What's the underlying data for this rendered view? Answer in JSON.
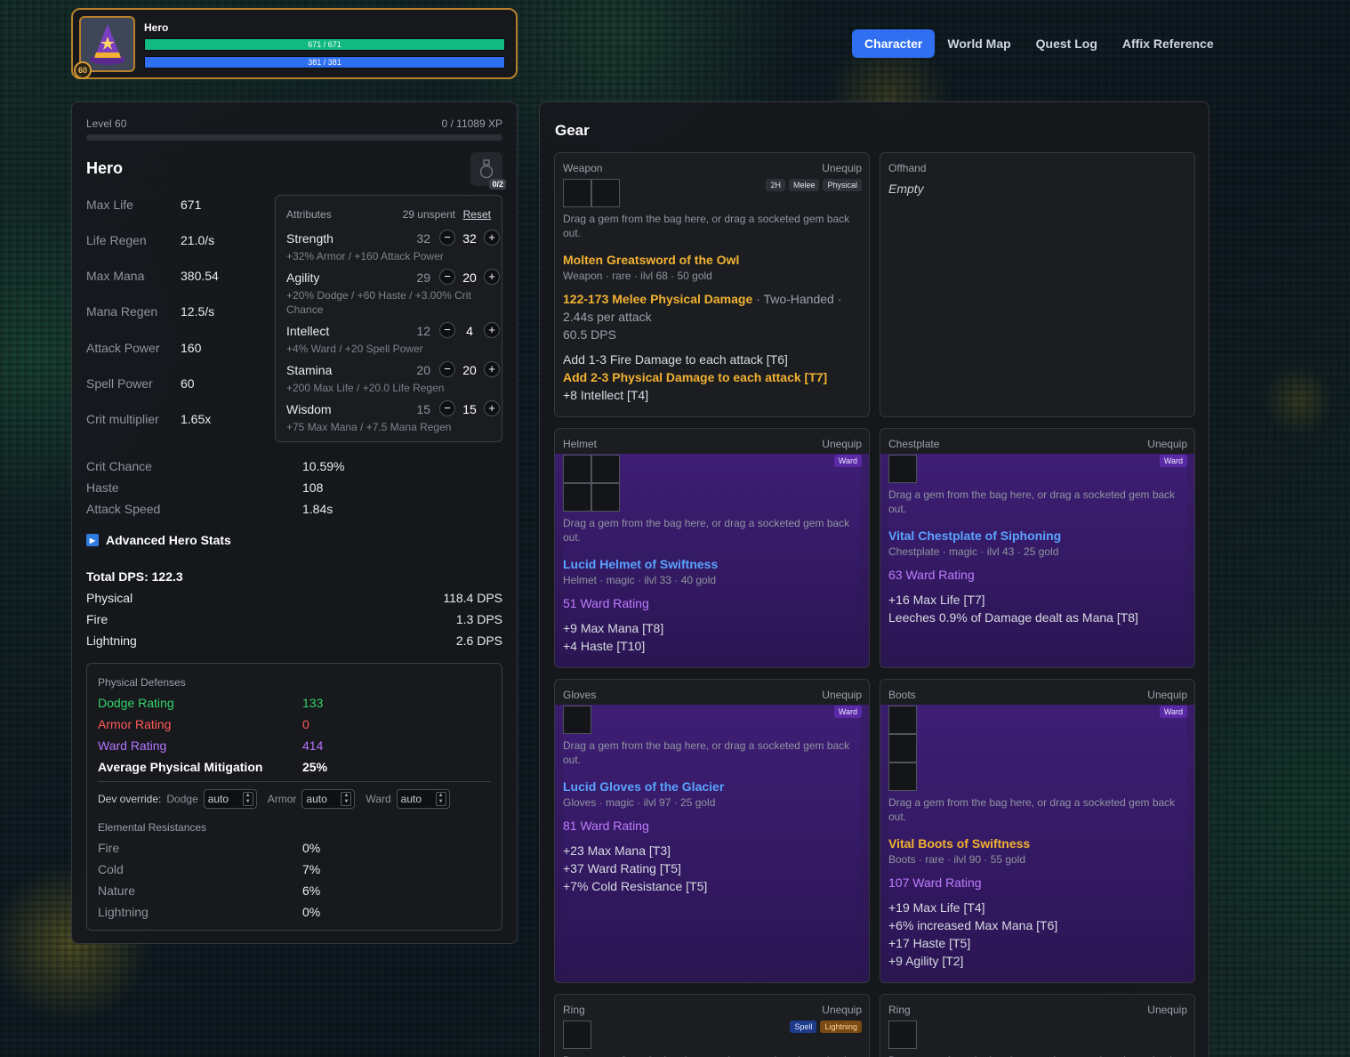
{
  "hero_frame": {
    "name": "Hero",
    "level": "60",
    "hp": "671 / 671",
    "mana": "381 / 381"
  },
  "nav": {
    "tabs": [
      "Character",
      "World Map",
      "Quest Log",
      "Affix Reference"
    ],
    "active": "Character"
  },
  "character": {
    "level_label": "Level 60",
    "xp": "0 / 11089 XP",
    "xp_progress": 0,
    "name": "Hero",
    "potions": "0/2",
    "stats": [
      {
        "label": "Max Life",
        "value": "671"
      },
      {
        "label": "Life Regen",
        "value": "21.0/s"
      },
      {
        "label": "Max Mana",
        "value": "380.54"
      },
      {
        "label": "Mana Regen",
        "value": "12.5/s"
      },
      {
        "label": "Attack Power",
        "value": "160"
      },
      {
        "label": "Spell Power",
        "value": "60"
      },
      {
        "label": "Crit multiplier",
        "value": "1.65x"
      }
    ],
    "attributes": {
      "title": "Attributes",
      "unspent": "29 unspent",
      "reset": "Reset",
      "items": [
        {
          "name": "Strength",
          "base": "32",
          "current": "32",
          "desc": "+32% Armor / +160 Attack Power"
        },
        {
          "name": "Agility",
          "base": "29",
          "current": "20",
          "desc": "+20% Dodge / +60 Haste / +3.00% Crit Chance"
        },
        {
          "name": "Intellect",
          "base": "12",
          "current": "4",
          "desc": "+4% Ward / +20 Spell Power"
        },
        {
          "name": "Stamina",
          "base": "20",
          "current": "20",
          "desc": "+200 Max Life / +20.0 Life Regen"
        },
        {
          "name": "Wisdom",
          "base": "15",
          "current": "15",
          "desc": "+75 Max Mana / +7.5 Mana Regen"
        }
      ]
    },
    "secondary": [
      {
        "label": "Crit Chance",
        "value": "10.59%"
      },
      {
        "label": "Haste",
        "value": "108"
      },
      {
        "label": "Attack Speed",
        "value": "1.84s"
      }
    ],
    "advanced_label": "Advanced Hero Stats",
    "dps": {
      "total": "Total DPS: 122.3",
      "rows": [
        {
          "label": "Physical",
          "value": "118.4 DPS"
        },
        {
          "label": "Fire",
          "value": "1.3 DPS"
        },
        {
          "label": "Lightning",
          "value": "2.6 DPS"
        }
      ]
    },
    "defenses": {
      "title": "Physical Defenses",
      "rows": [
        {
          "label": "Dodge Rating",
          "value": "133",
          "color": "#34d46b"
        },
        {
          "label": "Armor Rating",
          "value": "0",
          "color": "#ff5a5a"
        },
        {
          "label": "Ward Rating",
          "value": "414",
          "color": "#b574ff"
        },
        {
          "label": "Average Physical Mitigation",
          "value": "25%",
          "color": "#ffffff"
        }
      ],
      "dev_override": "Dev override:",
      "dev_fields": [
        {
          "label": "Dodge",
          "value": "auto"
        },
        {
          "label": "Armor",
          "value": "auto"
        },
        {
          "label": "Ward",
          "value": "auto"
        }
      ],
      "elem_title": "Elemental Resistances",
      "elem": [
        {
          "label": "Fire",
          "value": "0%"
        },
        {
          "label": "Cold",
          "value": "7%"
        },
        {
          "label": "Nature",
          "value": "6%"
        },
        {
          "label": "Lightning",
          "value": "0%"
        }
      ]
    }
  },
  "gear": {
    "title": "Gear",
    "unequip": "Unequip",
    "hint": "Drag a gem from the bag here, or drag a socketed gem back out.",
    "weapon": {
      "slot": "Weapon",
      "tags": [
        "2H",
        "Melee",
        "Physical"
      ],
      "name": "Molten Greatsword of the Owl",
      "meta": "Weapon · rare · ilvl 68 · 50 gold",
      "damage": "122-173 Melee Physical Damage",
      "damage_suffix": " · Two-Handed · 2.44s per attack",
      "dps": "60.5 DPS",
      "affixes": [
        "Add 1-3 Fire Damage to each attack [T6]",
        "Add 2-3 Physical Damage to each attack [T7]",
        "+8 Intellect [T4]"
      ]
    },
    "offhand": {
      "slot": "Offhand",
      "empty": "Empty"
    },
    "helmet": {
      "slot": "Helmet",
      "tag": "Ward",
      "name": "Lucid Helmet of Swiftness",
      "meta": "Helmet · magic · ilvl 33 · 40 gold",
      "base": "51 Ward Rating",
      "affixes": [
        "+9 Max Mana [T8]",
        "+4 Haste [T10]"
      ]
    },
    "chest": {
      "slot": "Chestplate",
      "tag": "Ward",
      "name": "Vital Chestplate of Siphoning",
      "meta": "Chestplate · magic · ilvl 43 · 25 gold",
      "base": "63 Ward Rating",
      "affixes": [
        "+16 Max Life [T7]",
        "Leeches 0.9% of Damage dealt as Mana [T8]"
      ]
    },
    "gloves": {
      "slot": "Gloves",
      "tag": "Ward",
      "name": "Lucid Gloves of the Glacier",
      "meta": "Gloves · magic · ilvl 97 · 25 gold",
      "base": "81 Ward Rating",
      "affixes": [
        "+23 Max Mana [T3]",
        "+37 Ward Rating [T5]",
        "+7% Cold Resistance [T5]"
      ]
    },
    "boots": {
      "slot": "Boots",
      "tag": "Ward",
      "name": "Vital Boots of Swiftness",
      "meta": "Boots · rare · ilvl 90 · 55 gold",
      "base": "107 Ward Rating",
      "affixes": [
        "+19 Max Life [T4]",
        "+6% increased Max Mana [T6]",
        "+17 Haste [T5]",
        "+9 Agility [T2]"
      ]
    },
    "ring1": {
      "slot": "Ring",
      "tags": [
        "Spell",
        "Lightning"
      ]
    },
    "ring2": {
      "slot": "Ring"
    }
  }
}
